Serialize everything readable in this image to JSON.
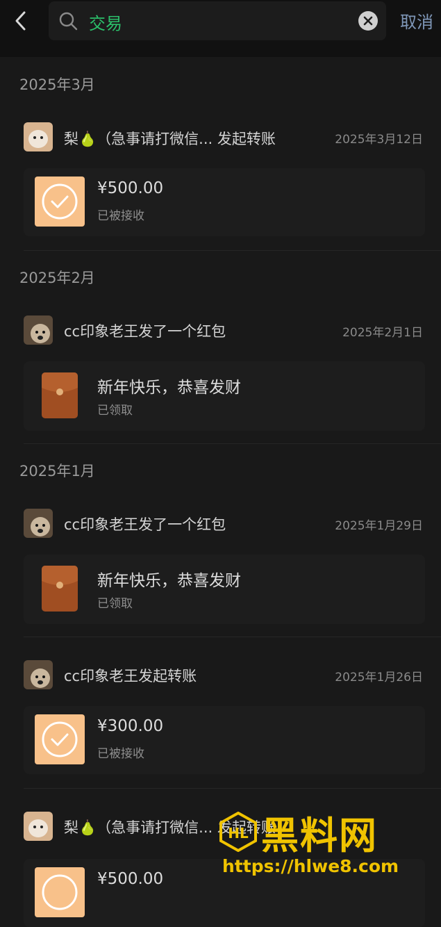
{
  "search": {
    "query": "交易",
    "cancel_label": "取消"
  },
  "groups": [
    {
      "title": "2025年3月",
      "items": [
        {
          "sender": "梨🍐（急事请打微信...  发起转账",
          "date": "2025年3月12日",
          "type": "transfer",
          "main": "¥500.00",
          "sub": "已被接收"
        }
      ]
    },
    {
      "title": "2025年2月",
      "items": [
        {
          "sender": "cc印象老王发了一个红包",
          "date": "2025年2月1日",
          "type": "red-packet",
          "main": "新年快乐，恭喜发财",
          "sub": "已领取"
        }
      ]
    },
    {
      "title": "2025年1月",
      "items": [
        {
          "sender": "cc印象老王发了一个红包",
          "date": "2025年1月29日",
          "type": "red-packet",
          "main": "新年快乐，恭喜发财",
          "sub": "已领取"
        },
        {
          "sender": "cc印象老王发起转账",
          "date": "2025年1月26日",
          "type": "transfer",
          "main": "¥300.00",
          "sub": "已被接收"
        },
        {
          "sender": "梨🍐（急事请打微信...  发起转账",
          "date": "",
          "type": "transfer",
          "main": "¥500.00",
          "sub": ""
        }
      ]
    }
  ],
  "watermark": {
    "brand": "黑料网",
    "url": "https://hlwe8.com"
  },
  "colors": {
    "background": "#191919",
    "accent_search": "#2bbf6a",
    "cancel": "#7f97b8",
    "transfer_icon": "#f8c18a",
    "red_packet": "#a04e22",
    "watermark": "#f0c300"
  }
}
